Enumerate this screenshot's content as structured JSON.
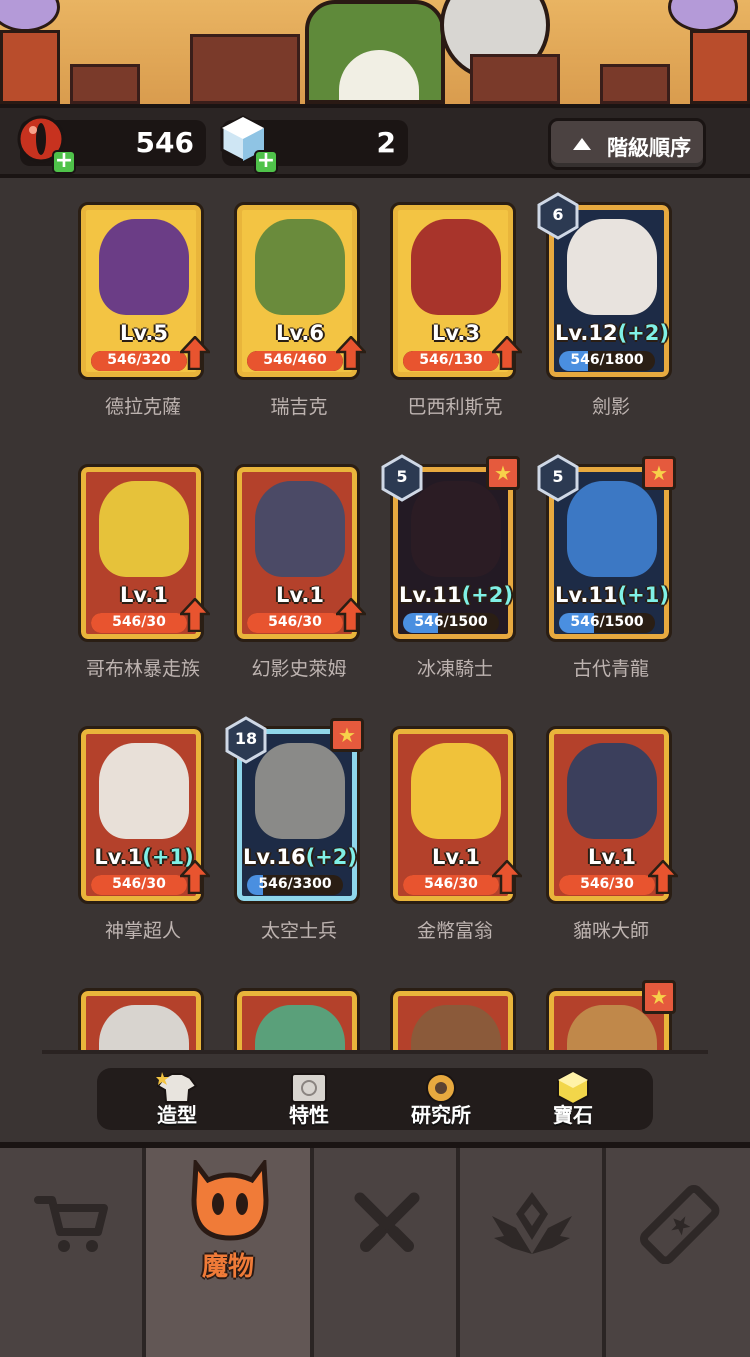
{
  "resources": {
    "eyes": {
      "value": "546"
    },
    "gems": {
      "value": "2"
    }
  },
  "sort_button": {
    "label": "階級順序"
  },
  "monsters": [
    {
      "name": "德拉克薩",
      "level": "Lv.5",
      "bonus": "",
      "progress": "546/320",
      "rarity": "gold",
      "upgradable": true,
      "badge": "",
      "star": false,
      "art_color": "#6b3d86"
    },
    {
      "name": "瑞吉克",
      "level": "Lv.6",
      "bonus": "",
      "progress": "546/460",
      "rarity": "gold",
      "upgradable": true,
      "badge": "",
      "star": false,
      "art_color": "#6a8b3c"
    },
    {
      "name": "巴西利斯克",
      "level": "Lv.3",
      "bonus": "",
      "progress": "546/130",
      "rarity": "gold",
      "upgradable": true,
      "badge": "",
      "star": false,
      "art_color": "#a8342b"
    },
    {
      "name": "劍影",
      "level": "Lv.12",
      "bonus": "(+2)",
      "progress": "546/1800",
      "rarity": "rare",
      "upgradable": false,
      "badge": "6",
      "star": false,
      "art_color": "#e8e3de"
    },
    {
      "name": "哥布林暴走族",
      "level": "Lv.1",
      "bonus": "",
      "progress": "546/30",
      "rarity": "red",
      "upgradable": true,
      "badge": "",
      "star": false,
      "art_color": "#e6c23a"
    },
    {
      "name": "幻影史萊姆",
      "level": "Lv.1",
      "bonus": "",
      "progress": "546/30",
      "rarity": "red",
      "upgradable": true,
      "badge": "",
      "star": false,
      "art_color": "#4b4a66"
    },
    {
      "name": "冰凍騎士",
      "level": "Lv.11",
      "bonus": "(+2)",
      "progress": "546/1500",
      "rarity": "dark",
      "upgradable": false,
      "badge": "5",
      "star": true,
      "art_color": "#2b1c24"
    },
    {
      "name": "古代青龍",
      "level": "Lv.11",
      "bonus": "(+1)",
      "progress": "546/1500",
      "rarity": "rare",
      "upgradable": false,
      "badge": "5",
      "star": true,
      "art_color": "#3c78c4"
    },
    {
      "name": "神掌超人",
      "level": "Lv.1",
      "bonus": "(+1)",
      "progress": "546/30",
      "rarity": "red",
      "upgradable": true,
      "badge": "",
      "star": false,
      "art_color": "#e8e0d8"
    },
    {
      "name": "太空士兵",
      "level": "Lv.16",
      "bonus": "(+2)",
      "progress": "546/3300",
      "rarity": "epic",
      "upgradable": false,
      "badge": "18",
      "star": true,
      "art_color": "#8a8a88"
    },
    {
      "name": "金幣富翁",
      "level": "Lv.1",
      "bonus": "",
      "progress": "546/30",
      "rarity": "red",
      "upgradable": true,
      "badge": "",
      "star": false,
      "art_color": "#f0c23a"
    },
    {
      "name": "貓咪大師",
      "level": "Lv.1",
      "bonus": "",
      "progress": "546/30",
      "rarity": "red",
      "upgradable": true,
      "badge": "",
      "star": false,
      "art_color": "#3b3f5c"
    },
    {
      "name": "",
      "level": "",
      "bonus": "",
      "progress": "",
      "rarity": "red",
      "upgradable": false,
      "badge": "",
      "star": false,
      "art_color": "#d8d4cf"
    },
    {
      "name": "",
      "level": "",
      "bonus": "",
      "progress": "",
      "rarity": "red",
      "upgradable": false,
      "badge": "",
      "star": false,
      "art_color": "#5aa07a"
    },
    {
      "name": "",
      "level": "",
      "bonus": "",
      "progress": "",
      "rarity": "red",
      "upgradable": false,
      "badge": "",
      "star": false,
      "art_color": "#8b5a3a"
    },
    {
      "name": "",
      "level": "",
      "bonus": "",
      "progress": "",
      "rarity": "red",
      "upgradable": false,
      "badge": "",
      "star": true,
      "art_color": "#c0884a"
    }
  ],
  "subtabs": [
    {
      "label": "造型",
      "icon": "shirt-icon"
    },
    {
      "label": "特性",
      "icon": "scroll-icon"
    },
    {
      "label": "研究所",
      "icon": "gear-icon"
    },
    {
      "label": "寶石",
      "icon": "gem-icon"
    }
  ],
  "nav": [
    {
      "label": "",
      "icon": "shop-cart-icon"
    },
    {
      "label": "魔物",
      "icon": "monster-face-icon",
      "active": true
    },
    {
      "label": "",
      "icon": "crossed-swords-icon"
    },
    {
      "label": "",
      "icon": "rank-wings-icon"
    },
    {
      "label": "",
      "icon": "ticket-icon"
    }
  ],
  "colors": {
    "accent_orange": "#f07b38",
    "upgrade_arrow": "#e8542f",
    "bonus_cyan": "#7ff0e6",
    "plus_green": "#4fc24a"
  }
}
